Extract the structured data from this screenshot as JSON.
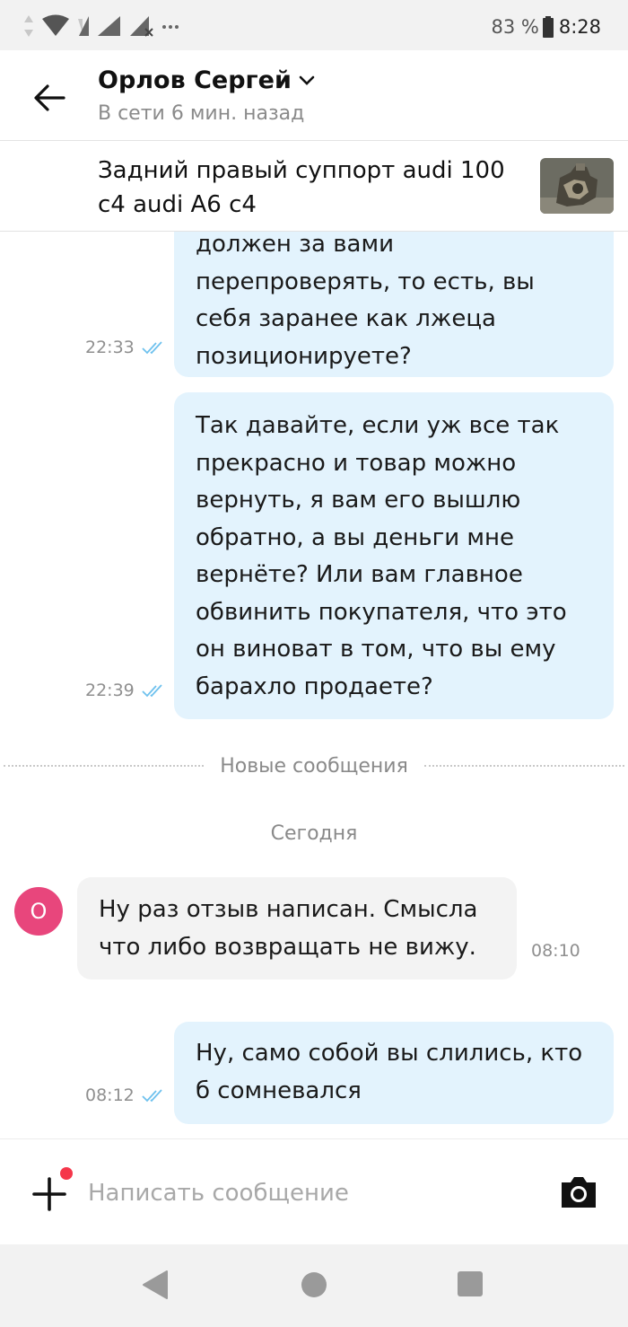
{
  "status_bar": {
    "battery": "83 %",
    "time": "8:28",
    "icons": [
      "data-arrows-icon",
      "wifi-icon",
      "signal-icon",
      "signal-icon",
      "signal-no-sim-icon",
      "more-dots-icon",
      "battery-icon"
    ]
  },
  "header": {
    "name": "Орлов Сергей",
    "status": "В сети 6 мин. назад"
  },
  "listing": {
    "title": "Задний правый суппорт audi 100 c4 audi A6 c4"
  },
  "messages": [
    {
      "direction": "out",
      "lines": [
        "должен за вами",
        "перепроверять, то есть, вы",
        "себя заранее как лжеца",
        "позиционируете?"
      ],
      "time": "22:33",
      "read": true
    },
    {
      "direction": "out",
      "lines": [
        "Так давайте, если уж все так",
        "прекрасно и товар можно",
        "вернуть, я вам его вышлю",
        "обратно, а вы деньги мне",
        "вернёте? Или вам главное",
        "обвинить покупателя, что это",
        "он виноват в том, что вы ему",
        "барахло продаете?"
      ],
      "time": "22:39",
      "read": true
    },
    {
      "direction": "in",
      "avatar_letter": "О",
      "lines": [
        "Ну раз отзыв написан. Смысла",
        "что либо возвращать не вижу."
      ],
      "time": "08:10"
    },
    {
      "direction": "out",
      "lines": [
        "Ну, само собой вы слились, кто",
        "б сомневался"
      ],
      "time": "08:12",
      "read": true
    }
  ],
  "divider_label": "Новые сообщения",
  "date_label": "Сегодня",
  "input": {
    "placeholder": "Написать сообщение",
    "value": ""
  },
  "colors": {
    "outgoing_bubble": "#e3f3fd",
    "incoming_bubble": "#f3f3f3",
    "read_check": "#6ec1ee",
    "avatar": "#e8467c",
    "notification_dot": "#f5364a"
  }
}
